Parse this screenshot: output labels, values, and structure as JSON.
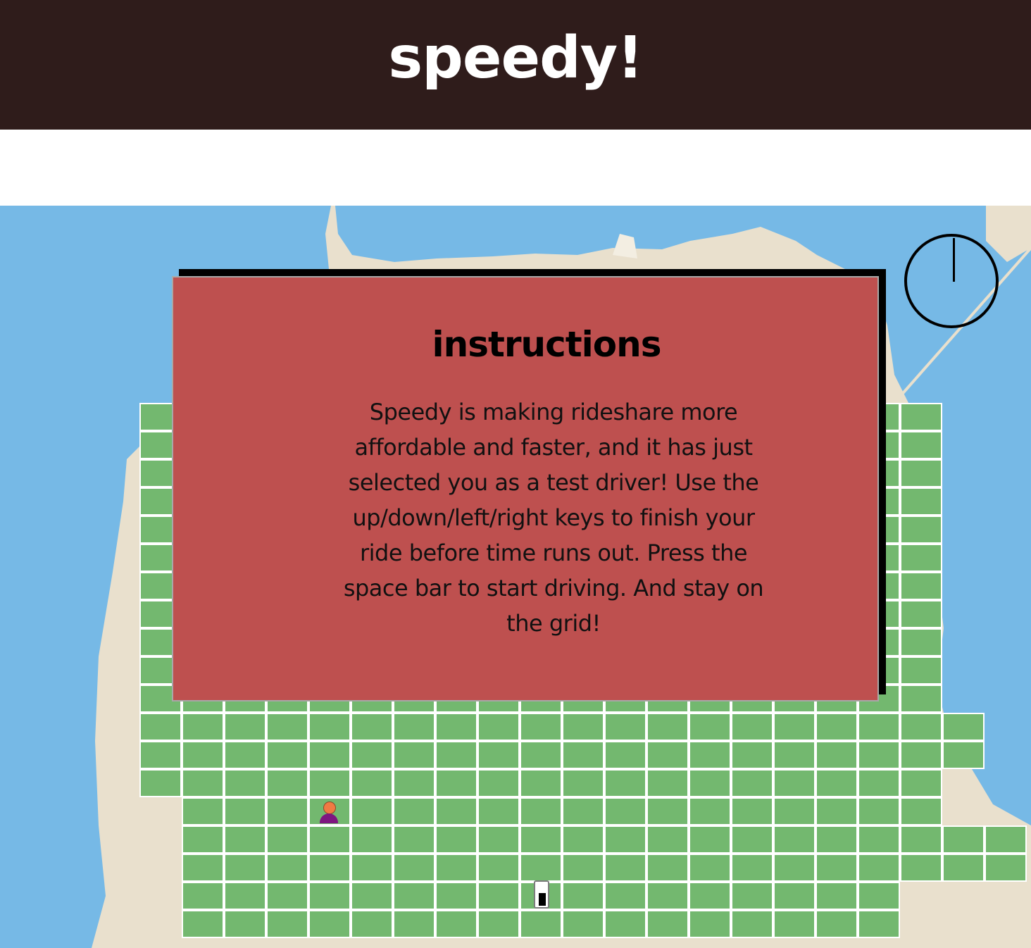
{
  "header": {
    "title": "speedy!"
  },
  "game": {
    "timer_icon": "clock-timer-icon",
    "passenger_icon": "passenger-icon",
    "car_icon": "car-icon",
    "colors": {
      "header_bg": "#2f1c1b",
      "water": "#76b9e6",
      "land": "#e9e0cd",
      "grid": "#73b86f",
      "modal": "#be504f",
      "passenger_head": "#ef7a43",
      "passenger_body": "#7e1680"
    }
  },
  "modal": {
    "title": "instructions",
    "body": "Speedy is making rideshare more affordable and faster, and it has just selected you as a test driver! Use the up/down/left/right keys to finish your ride before time runs out. Press the space bar to start driving. And stay on the grid!"
  }
}
